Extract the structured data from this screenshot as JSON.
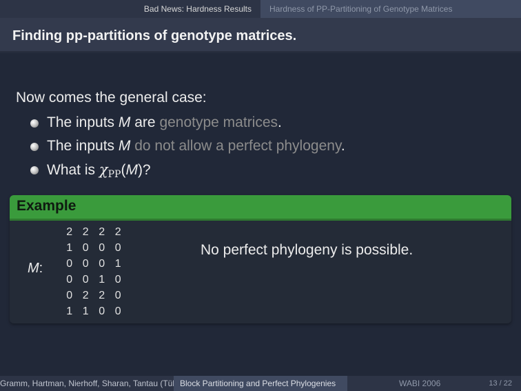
{
  "header": {
    "section": "Bad News: Hardness Results",
    "subsection": "Hardness of PP-Partitioning of Genotype Matrices"
  },
  "frame": {
    "title": "Finding pp-partitions of genotype matrices."
  },
  "content": {
    "intro": "Now comes the general case:",
    "bullet1": {
      "a": "The inputs ",
      "b": "M",
      "c": " are ",
      "d": "genotype matrices",
      "e": "."
    },
    "bullet2": {
      "a": "The inputs ",
      "b": "M",
      "c": " do not allow a perfect phylogeny",
      "d": "."
    },
    "bullet3": {
      "a": "What is ",
      "chi": "χ",
      "sub": "PP",
      "b": "(",
      "m": "M",
      "c": ")?"
    }
  },
  "example": {
    "title": "Example",
    "matrix_label": "M",
    "matrix_colon": ":",
    "rows": [
      [
        "2",
        "2",
        "2",
        "2"
      ],
      [
        "1",
        "0",
        "0",
        "0"
      ],
      [
        "0",
        "0",
        "0",
        "1"
      ],
      [
        "0",
        "0",
        "1",
        "0"
      ],
      [
        "0",
        "2",
        "2",
        "0"
      ],
      [
        "1",
        "1",
        "0",
        "0"
      ]
    ],
    "note": "No perfect phylogeny is possible."
  },
  "footer": {
    "authors": "Gramm, Hartman, Nierhoff, Sharan, Tantau  (Tübingen, Berkeley, Tel Aviv, Lübeck)",
    "title": "Block Partitioning and Perfect Phylogenies",
    "venue": "WABI 2006",
    "page": "13 / 22"
  },
  "colors": {
    "background": "#212838",
    "block_title": "#3a9b3c",
    "highlight_gray": "#8c8c8c"
  }
}
